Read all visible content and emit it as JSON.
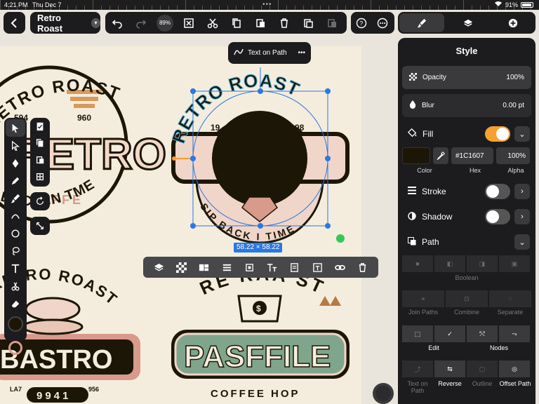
{
  "status": {
    "time": "4:21 PM",
    "date": "Thu Dec 7",
    "battery": "91%"
  },
  "toolbar": {
    "doc_title": "Retro Roast",
    "zoom": "89%"
  },
  "floating": {
    "text_on_path_label": "Text on Path",
    "size_badge": "58.22 × 58.22"
  },
  "panel": {
    "title": "Style",
    "opacity": {
      "label": "Opacity",
      "value": "100%"
    },
    "blur": {
      "label": "Blur",
      "value": "0.00 pt"
    },
    "fill": {
      "label": "Fill",
      "enabled": true,
      "color_label": "Color",
      "hex_label": "Hex",
      "alpha_label": "Alpha",
      "hex_value": "#1C1607",
      "alpha_value": "100%",
      "color": "#1C1607"
    },
    "stroke": {
      "label": "Stroke",
      "enabled": false
    },
    "shadow": {
      "label": "Shadow",
      "enabled": false
    },
    "path": {
      "label": "Path",
      "boolean_label": "Boolean",
      "join_paths": "Join Paths",
      "combine": "Combine",
      "separate": "Separate",
      "edit": "Edit",
      "nodes": "Nodes",
      "text_on_path": "Text on Path",
      "reverse": "Reverse",
      "outline": "Outline",
      "offset_path": "Offset Path"
    }
  },
  "artwork": {
    "top_left": {
      "arc_text": "RETRO ROAST",
      "year_left": "594",
      "year_right": "960",
      "big_text": "RETRO",
      "sub_text": "OFFE",
      "bottom_arc": "BACK IN TME"
    },
    "top_center": {
      "arc_text": "RETRO ROAST",
      "year_left": "19",
      "year_right": "98",
      "bottom_arc": "SIP BACK I TIME"
    },
    "bottom_left": {
      "arc_text": "RETRO ROAST",
      "big_text": "BASTRO",
      "num_left": "LA7",
      "num_right": "956",
      "num_box": "9941"
    },
    "bottom_center": {
      "arc_text": "RE RAA ST",
      "big_text": "PASFFILE",
      "sub_text": "COFFEE HOP"
    }
  },
  "colors": {
    "accent": "#F7A030",
    "selection": "#2A78E4",
    "ink": "#1C1607",
    "cream": "#F4EDDD",
    "rose": "#D89A8A",
    "sage": "#7FA58C"
  }
}
